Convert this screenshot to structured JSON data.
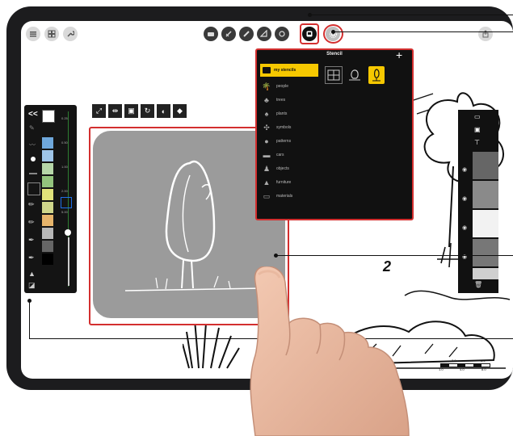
{
  "stencil": {
    "title": "Stencil",
    "add_label": "+",
    "selected_folder": "my stencils",
    "items": [
      {
        "icon": "palm-tree-icon",
        "label": "people"
      },
      {
        "icon": "tree-icon",
        "label": "trees"
      },
      {
        "icon": "plant-icon",
        "label": "plants"
      },
      {
        "icon": "symbol-icon",
        "label": "symbols"
      },
      {
        "icon": "bush-icon",
        "label": "patterns"
      },
      {
        "icon": "car-icon",
        "label": "cars"
      },
      {
        "icon": "figure-icon",
        "label": "objects"
      },
      {
        "icon": "person-icon",
        "label": "furniture"
      },
      {
        "icon": "bench-icon",
        "label": "materials"
      }
    ]
  },
  "canvas": {
    "callout_number": "2",
    "scale_bar": {
      "top": [
        "2.0",
        "6.0"
      ],
      "bottom": [
        "1.0",
        "4.0",
        "8.0"
      ]
    }
  },
  "palette": {
    "back_label": "<<",
    "colors": [
      "#6fa8dc",
      "#9fc5e8",
      "#b6d7a8",
      "#93c47d",
      "#e1e37a",
      "#cfd68a",
      "#e6b46b",
      "#b7b7b7",
      "#666666",
      "#000000"
    ],
    "slider_values": [
      "0.25",
      "0.50",
      "1.00",
      "2.00",
      "5.00"
    ]
  },
  "colors": {
    "accent_red": "#d32f2f",
    "selected_yellow": "#f6c800",
    "panel_dark": "#111111"
  }
}
